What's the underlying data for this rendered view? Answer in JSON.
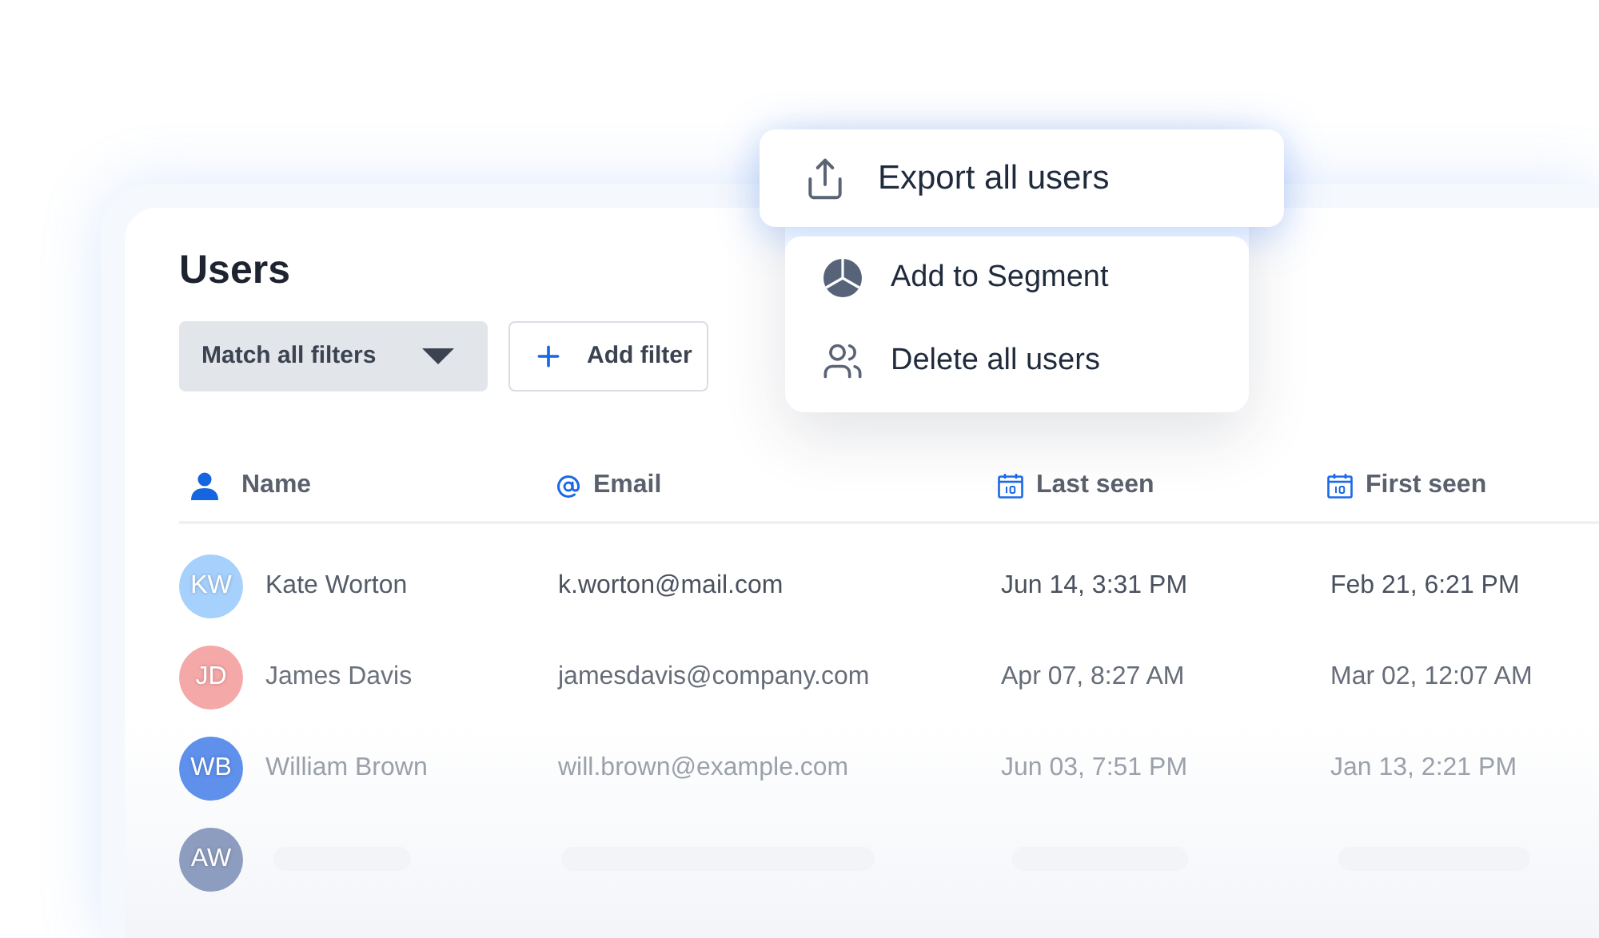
{
  "title": "Users",
  "filter_select": {
    "value": "Match all filters"
  },
  "add_filter_button": {
    "label": "Add filter"
  },
  "menu": {
    "items": [
      {
        "kind": "export",
        "label": "Export all users",
        "selected": true
      },
      {
        "kind": "segment",
        "label": "Add to Segment",
        "selected": false
      },
      {
        "kind": "delete",
        "label": "Delete all users",
        "selected": false
      }
    ]
  },
  "table": {
    "columns": [
      {
        "kind": "person",
        "label": "Name"
      },
      {
        "kind": "email",
        "label": "Email"
      },
      {
        "kind": "date",
        "label": "Last seen"
      },
      {
        "kind": "date",
        "label": "First seen"
      }
    ],
    "rows": [
      {
        "kind": "user",
        "initials": "KW",
        "color": "#a6d1fc",
        "name": "Kate Worton",
        "email": "k.worton@mail.com",
        "last_seen": "Jun 14, 3:31 PM",
        "first_seen": "Feb 21, 6:21 PM"
      },
      {
        "kind": "user",
        "initials": "JD",
        "color": "#f5a8a8",
        "name": "James Davis",
        "email": "jamesdavis@company.com",
        "last_seen": "Apr 07, 8:27 AM",
        "first_seen": "Mar 02, 12:07 AM"
      },
      {
        "kind": "user",
        "initials": "WB",
        "color": "#5e90ec",
        "name": "William Brown",
        "email": "will.brown@example.com",
        "last_seen": "Jun 03, 7:51 PM",
        "first_seen": "Jan 13, 2:21 PM"
      },
      {
        "kind": "loading",
        "initials": "AW",
        "color": "#8d9dbf"
      }
    ]
  }
}
